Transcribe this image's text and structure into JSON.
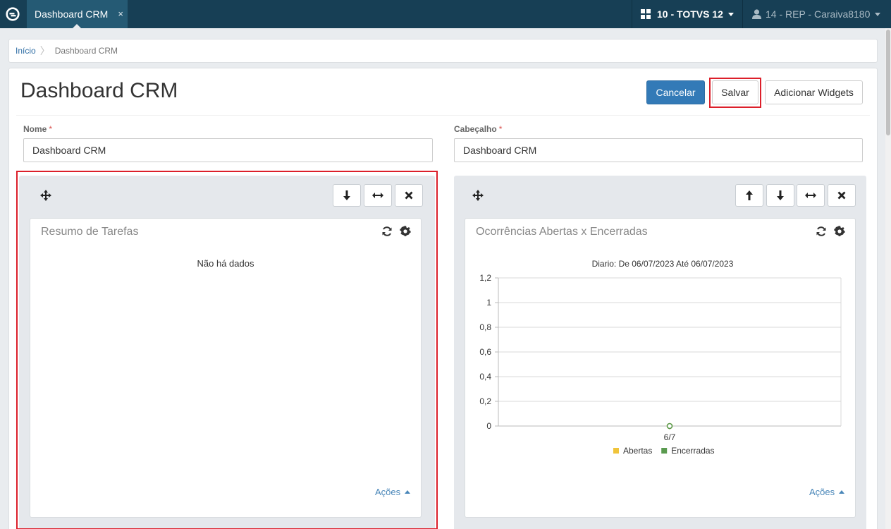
{
  "topbar": {
    "tab_label": "Dashboard CRM",
    "tab_close": "×",
    "company": "10 - TOTVS 12",
    "user": "14 - REP - Caraiva8180"
  },
  "breadcrumb": {
    "home": "Início",
    "current": "Dashboard CRM"
  },
  "page": {
    "title": "Dashboard CRM",
    "buttons": {
      "cancel": "Cancelar",
      "save": "Salvar",
      "add_widgets": "Adicionar Widgets"
    },
    "fields": {
      "nome_label": "Nome",
      "nome_value": "Dashboard CRM",
      "cabecalho_label": "Cabeçalho",
      "cabecalho_value": "Dashboard CRM",
      "required_mark": "*"
    }
  },
  "widgets": [
    {
      "title": "Resumo de Tarefas",
      "empty_text": "Não há dados",
      "actions_label": "Ações"
    },
    {
      "title": "Ocorrências Abertas x Encerradas",
      "actions_label": "Ações"
    }
  ],
  "colors": {
    "topbar": "#173f55",
    "active_tab": "#255a74",
    "primary": "#337ab7",
    "highlight": "#dc1f2a",
    "series_abertas": "#f0c43a",
    "series_encerradas": "#5a9a4f"
  },
  "icons": [
    "logo-icon",
    "grid-icon",
    "user-icon",
    "move-icon",
    "arrow-down-icon",
    "arrow-up-icon",
    "resize-horizontal-icon",
    "close-icon",
    "refresh-icon",
    "gear-icon"
  ],
  "chart_data": {
    "type": "line",
    "title": "Diario: De 06/07/2023 Até 06/07/2023",
    "categories": [
      "6/7"
    ],
    "series": [
      {
        "name": "Abertas",
        "values": [
          0
        ]
      },
      {
        "name": "Encerradas",
        "values": [
          0
        ]
      }
    ],
    "ylim": [
      0,
      1.2
    ],
    "yticks": [
      "0",
      "0,2",
      "0,4",
      "0,6",
      "0,8",
      "1",
      "1,2"
    ],
    "grid": true,
    "legend": "bottom"
  }
}
